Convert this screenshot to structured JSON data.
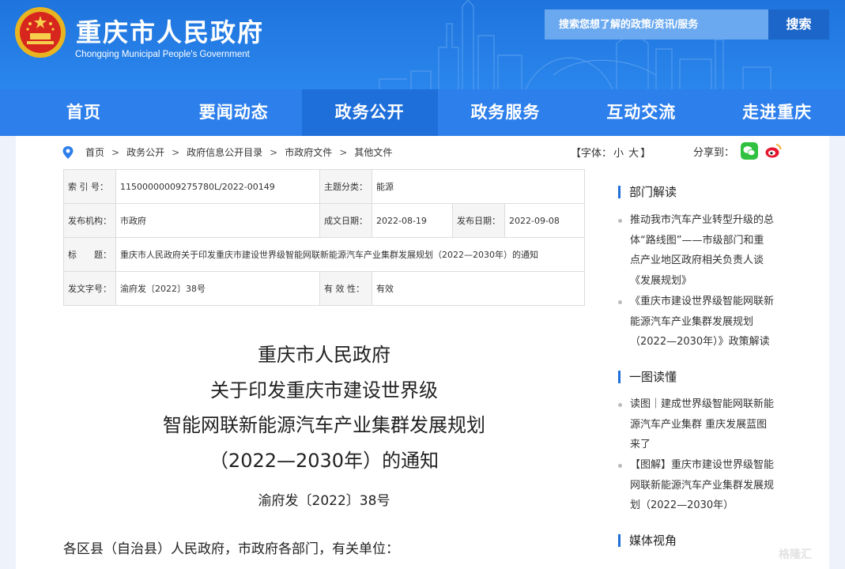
{
  "header": {
    "title": "重庆市人民政府",
    "subtitle": "Chongqing Municipal People's Government",
    "search_placeholder": "搜索您想了解的政策/资讯/服务",
    "search_button": "搜索"
  },
  "nav": {
    "items": [
      "首页",
      "要闻动态",
      "政务公开",
      "政务服务",
      "互动交流",
      "走进重庆"
    ],
    "active_index": 2
  },
  "breadcrumb": [
    "首页",
    "政务公开",
    "政府信息公开目录",
    "市政府文件",
    "其他文件"
  ],
  "font_size": {
    "label": "【字体：",
    "small": "小",
    "large": "大",
    "close": "】"
  },
  "share": {
    "label": "分享到："
  },
  "meta": {
    "index_no_label": "索 引 号：",
    "index_no": "11500000009275780L/2022-00149",
    "topic_label": "主题分类：",
    "topic": "能源",
    "issuer_label": "发布机构：",
    "issuer": "市政府",
    "written_label": "成文日期：",
    "written_date": "2022-08-19",
    "published_label": "发布日期：",
    "published_date": "2022-09-08",
    "title_label": "标　　题：",
    "title": "重庆市人民政府关于印发重庆市建设世界级智能网联新能源汽车产业集群发展规划（2022—2030年）的通知",
    "doc_no_label": "发文字号：",
    "doc_no": "渝府发〔2022〕38号",
    "validity_label": "有 效 性：",
    "validity": "有效"
  },
  "document": {
    "title_lines": [
      "重庆市人民政府",
      "关于印发重庆市建设世界级",
      "智能网联新能源汽车产业集群发展规划",
      "（2022—2030年）的通知"
    ],
    "number": "渝府发〔2022〕38号",
    "salutation": "各区县（自治县）人民政府，市政府各部门，有关单位："
  },
  "sidebar": {
    "sections": [
      {
        "title": "部门解读",
        "links": [
          [
            "推动我市汽车产业转型升级的总",
            "体“路线图”——市级部门和重",
            "点产业地区政府相关负责人谈",
            "《发展规划》"
          ],
          [
            "《重庆市建设世界级智能网联新",
            "能源汽车产业集群发展规划",
            "（2022—2030年）》政策解读"
          ]
        ]
      },
      {
        "title": "一图读懂",
        "links": [
          [
            "读图｜建成世界级智能网联新能",
            "源汽车产业集群 重庆发展蓝图",
            "来了"
          ],
          [
            "【图解】重庆市建设世界级智能",
            "网联新能源汽车产业集群发展规",
            "划（2022—2030年）"
          ]
        ]
      },
      {
        "title": "媒体视角",
        "links": []
      }
    ]
  },
  "watermark": "格隆汇",
  "colors": {
    "primary": "#2d7fec",
    "nav_active": "#1f6fdb",
    "header": "#1f74dd"
  }
}
